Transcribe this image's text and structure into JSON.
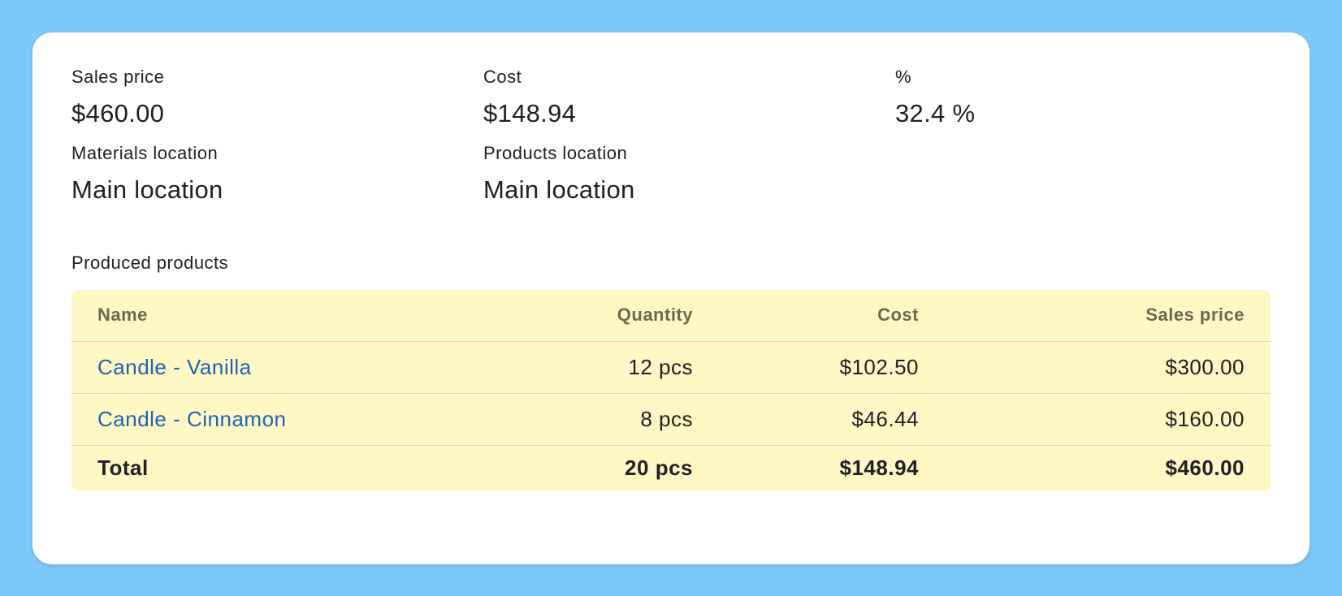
{
  "summary": {
    "sales_price": {
      "label": "Sales price",
      "value": "$460.00"
    },
    "cost": {
      "label": "Cost",
      "value": "$148.94"
    },
    "percent": {
      "label": "%",
      "value": "32.4 %"
    },
    "materials_location": {
      "label": "Materials location",
      "value": "Main location"
    },
    "products_location": {
      "label": "Products location",
      "value": "Main location"
    }
  },
  "produced_products": {
    "title": "Produced products",
    "columns": [
      "Name",
      "Quantity",
      "Cost",
      "Sales price"
    ],
    "rows": [
      {
        "name": "Candle - Vanilla",
        "quantity": "12 pcs",
        "cost": "$102.50",
        "sales_price": "$300.00"
      },
      {
        "name": "Candle - Cinnamon",
        "quantity": "8 pcs",
        "cost": "$46.44",
        "sales_price": "$160.00"
      }
    ],
    "total": {
      "label": "Total",
      "quantity": "20 pcs",
      "cost": "$148.94",
      "sales_price": "$460.00"
    }
  },
  "colors": {
    "page_background": "#7ec8fa",
    "card_background": "#ffffff",
    "table_background": "#fff8c5",
    "link": "#1f64b0",
    "header_text": "#6b6a50"
  }
}
